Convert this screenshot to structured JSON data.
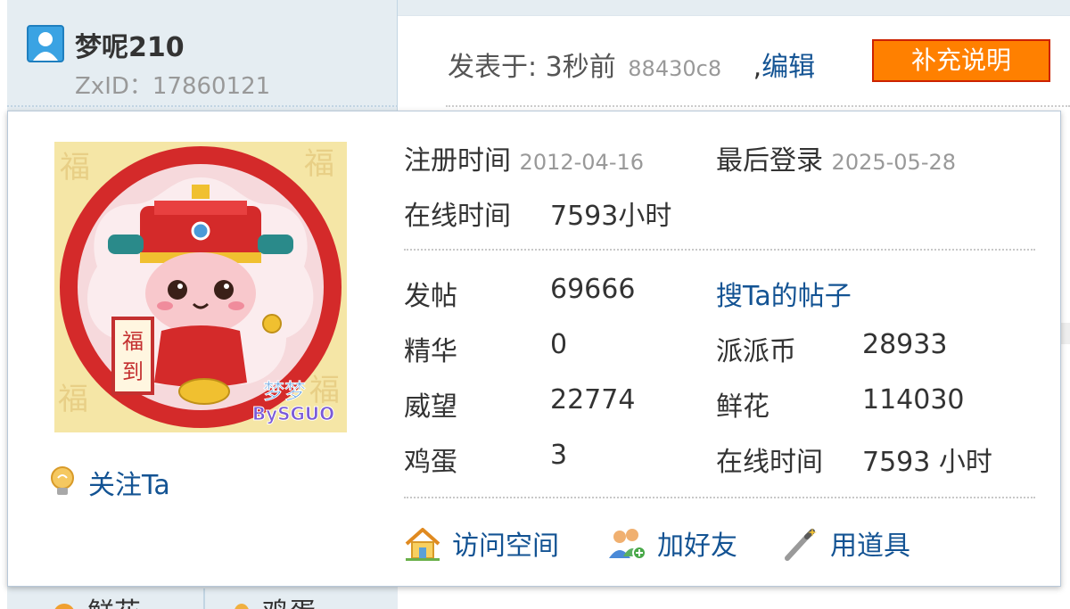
{
  "post_header": {
    "username": "梦呢210",
    "zxid": "ZxID：17860121",
    "posted_label": "发表于: 3秒前",
    "post_hash": "88430c8",
    "separator": ",",
    "edit_label": "编辑",
    "supplement_button": "补充说明"
  },
  "card": {
    "registration": {
      "label": "注册时间",
      "value": "2012-04-16"
    },
    "last_login": {
      "label": "最后登录",
      "value": "2025-05-28"
    },
    "online_time_top": {
      "label": "在线时间",
      "value": "7593小时"
    },
    "stats": [
      {
        "label": "发帖",
        "value": "69666"
      },
      {
        "label": "精华",
        "value": "0"
      },
      {
        "label": "威望",
        "value": "22774"
      },
      {
        "label": "鸡蛋",
        "value": "3"
      }
    ],
    "stats_right": [
      {
        "label": "派派币",
        "value": "28933"
      },
      {
        "label": "鲜花",
        "value": "114030"
      },
      {
        "label": "在线时间",
        "value": "7593 小时"
      }
    ],
    "search_posts_link": "搜Ta的帖子",
    "follow_label": "关注Ta",
    "avatar_caption": "梦梦",
    "avatar_signature": "BySGUO",
    "avatar_scroll_text": "福到",
    "actions": {
      "visit_space": "访问空间",
      "add_friend": "加好友",
      "use_item": "用道具"
    }
  },
  "footer_strip": {
    "flower_label": "鲜花",
    "egg_label": "鸡蛋"
  },
  "colors": {
    "link": "#135393",
    "accent_button": "#ff8000",
    "panel_bg": "#e5edf2"
  }
}
